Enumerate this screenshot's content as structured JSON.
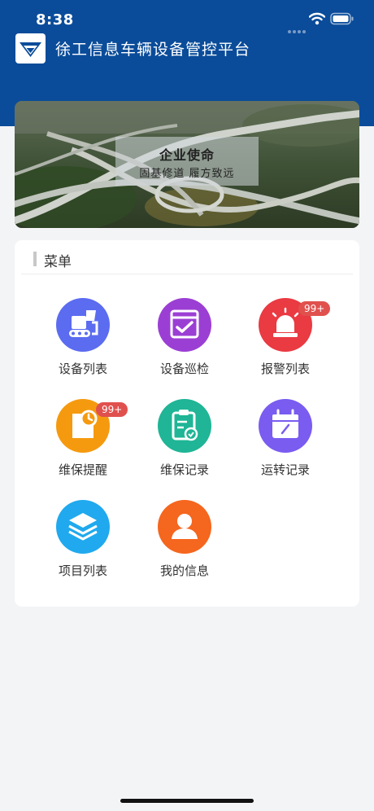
{
  "status_bar": {
    "time": "8:38"
  },
  "header": {
    "title": "徐工信息车辆设备管控平台"
  },
  "banner": {
    "title": "企业使命",
    "subtitle": "固基修道  履方致远"
  },
  "menu": {
    "title": "菜单",
    "items": [
      {
        "label": "设备列表",
        "icon": "equipment-icon",
        "color": "#5b6cf0"
      },
      {
        "label": "设备巡检",
        "icon": "inspection-icon",
        "color": "#9b3fd4"
      },
      {
        "label": "报警列表",
        "icon": "alarm-icon",
        "color": "#ea3a42",
        "badge": "99+"
      },
      {
        "label": "维保提醒",
        "icon": "maintenance-reminder-icon",
        "color": "#f59a0f",
        "badge": "99+"
      },
      {
        "label": "维保记录",
        "icon": "maintenance-record-icon",
        "color": "#1fb596"
      },
      {
        "label": "运转记录",
        "icon": "operation-record-icon",
        "color": "#7a5cf0"
      },
      {
        "label": "项目列表",
        "icon": "layers-icon",
        "color": "#20a9ee"
      },
      {
        "label": "我的信息",
        "icon": "user-icon",
        "color": "#f5661e"
      }
    ]
  },
  "colors": {
    "header_bg": "#0a4c9a",
    "badge": "#e0514e",
    "page_bg": "#f3f4f6"
  }
}
